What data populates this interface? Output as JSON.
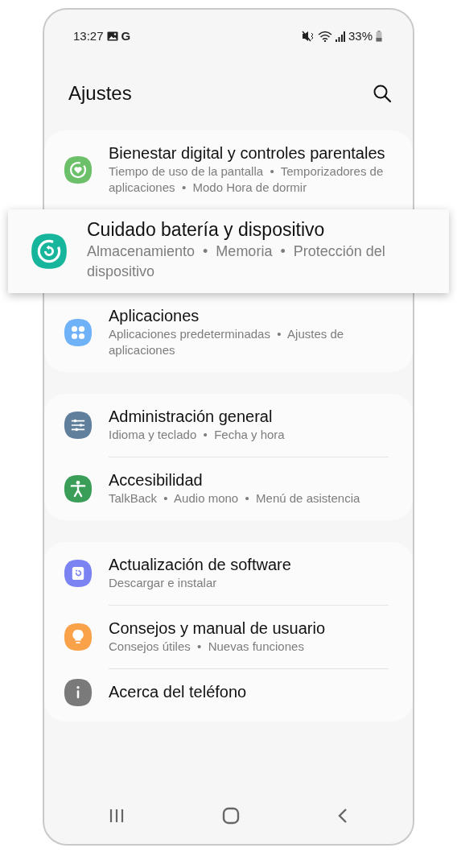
{
  "status_bar": {
    "time": "13:27",
    "account": "G",
    "battery": "33%"
  },
  "header": {
    "title": "Ajustes"
  },
  "groups": [
    {
      "items": [
        {
          "kind": "normal",
          "title": "Bienestar digital y controles parentales",
          "subtitle": "Tiempo de uso de la pantalla  •  Temporizadores de aplicaciones  •  Modo Hora de dormir",
          "color": "#6cc06a"
        },
        {
          "kind": "highlight",
          "title": "Cuidado batería y dispositivo",
          "subtitle": "Almacenamiento  •  Memoria  •  Protección del dispositivo",
          "color": "#17b59b"
        },
        {
          "kind": "normal",
          "title": "Aplicaciones",
          "subtitle": "Aplicaciones predeterminadas  •  Ajustes de aplicaciones",
          "color": "#70b2f7"
        }
      ]
    },
    {
      "items": [
        {
          "kind": "normal",
          "title": "Administración general",
          "subtitle": "Idioma y teclado  •  Fecha y hora",
          "color": "#5f7f9c"
        },
        {
          "kind": "normal",
          "title": "Accesibilidad",
          "subtitle": "TalkBack  •  Audio mono  •  Menú de asistencia",
          "color": "#3a9e58"
        }
      ]
    },
    {
      "items": [
        {
          "kind": "normal",
          "title": "Actualización de software",
          "subtitle": "Descargar e instalar",
          "color": "#7b82f2"
        },
        {
          "kind": "normal",
          "title": "Consejos y manual de usuario",
          "subtitle": "Consejos útiles  •  Nuevas funciones",
          "color": "#f9a24a"
        },
        {
          "kind": "normal",
          "title": "Acerca del teléfono",
          "color": "#7a7a7a"
        }
      ]
    }
  ]
}
